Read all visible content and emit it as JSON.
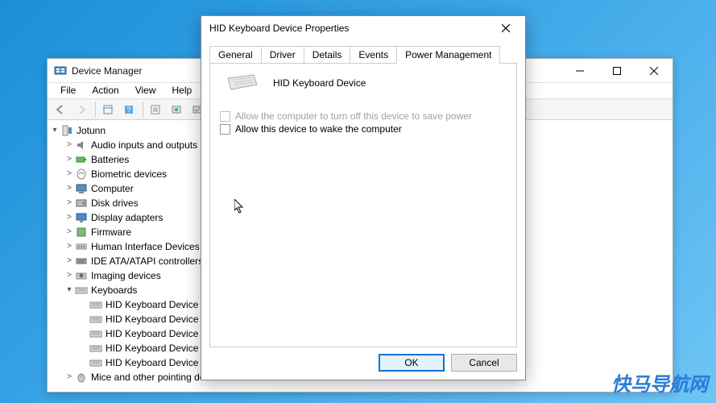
{
  "deviceManager": {
    "title": "Device Manager",
    "menus": [
      "File",
      "Action",
      "View",
      "Help"
    ],
    "root": "Jotunn",
    "categories": [
      {
        "label": "Audio inputs and outputs",
        "expanded": false,
        "icon": "audio"
      },
      {
        "label": "Batteries",
        "expanded": false,
        "icon": "battery"
      },
      {
        "label": "Biometric devices",
        "expanded": false,
        "icon": "biometric"
      },
      {
        "label": "Computer",
        "expanded": false,
        "icon": "computer"
      },
      {
        "label": "Disk drives",
        "expanded": false,
        "icon": "disk"
      },
      {
        "label": "Display adapters",
        "expanded": false,
        "icon": "display"
      },
      {
        "label": "Firmware",
        "expanded": false,
        "icon": "firmware"
      },
      {
        "label": "Human Interface Devices",
        "expanded": false,
        "icon": "hid"
      },
      {
        "label": "IDE ATA/ATAPI controllers",
        "expanded": false,
        "icon": "ide"
      },
      {
        "label": "Imaging devices",
        "expanded": false,
        "icon": "imaging"
      },
      {
        "label": "Keyboards",
        "expanded": true,
        "icon": "keyboard",
        "children": [
          "HID Keyboard Device",
          "HID Keyboard Device",
          "HID Keyboard Device",
          "HID Keyboard Device",
          "HID Keyboard Device"
        ]
      },
      {
        "label": "Mice and other pointing devices",
        "expanded": false,
        "icon": "mouse"
      }
    ]
  },
  "properties": {
    "title": "HID Keyboard Device Properties",
    "tabs": [
      "General",
      "Driver",
      "Details",
      "Events",
      "Power Management"
    ],
    "activeTab": 4,
    "deviceName": "HID Keyboard Device",
    "option1": "Allow the computer to turn off this device to save power",
    "option1_enabled": false,
    "option1_checked": false,
    "option2": "Allow this device to wake the computer",
    "option2_enabled": true,
    "option2_checked": false,
    "okLabel": "OK",
    "cancelLabel": "Cancel"
  },
  "watermark": "快马导航网"
}
